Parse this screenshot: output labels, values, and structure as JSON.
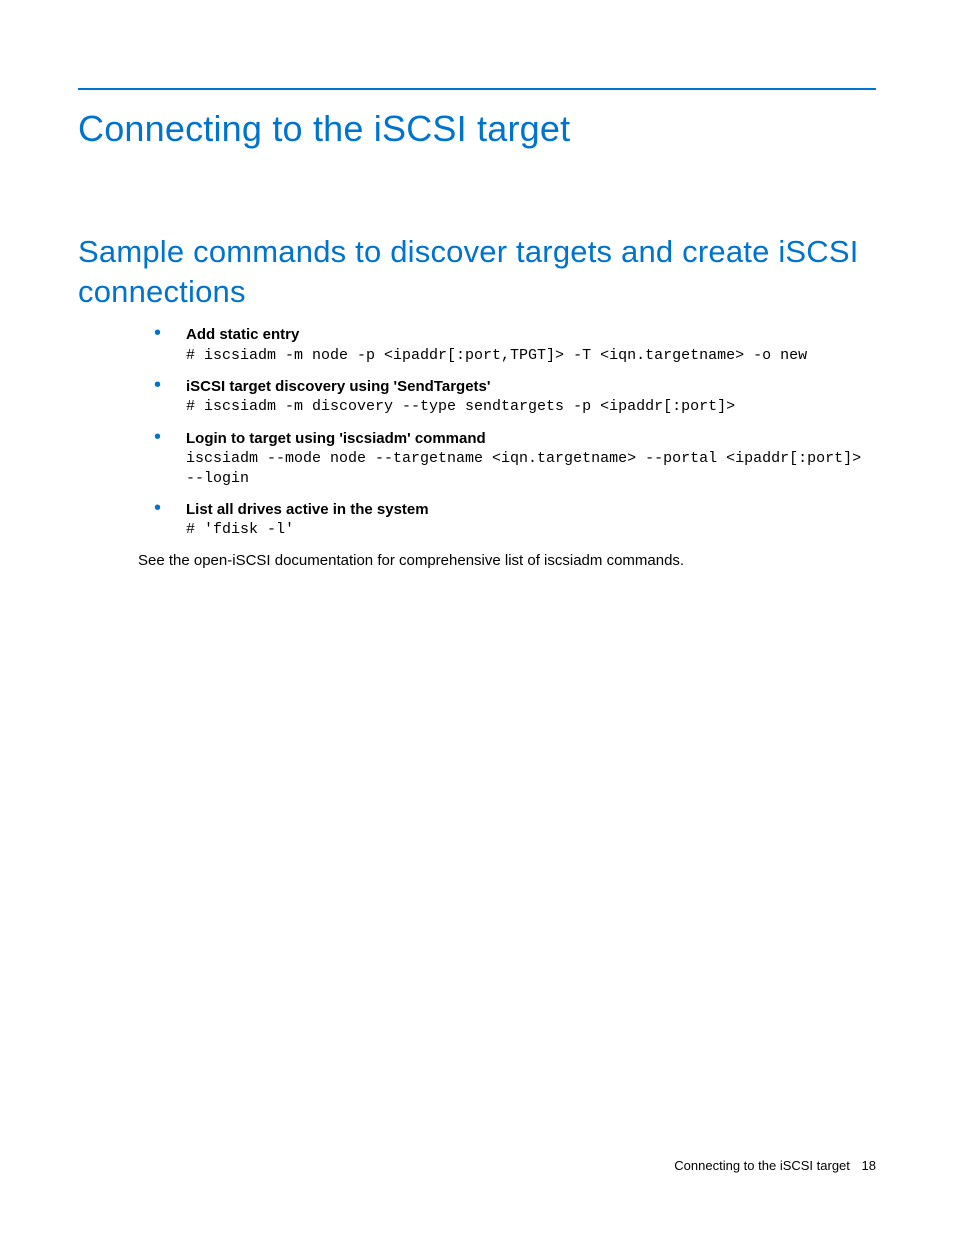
{
  "heading1": "Connecting to the iSCSI target",
  "heading2": "Sample commands to discover targets and create iSCSI connections",
  "items": [
    {
      "title": "Add static entry",
      "code": "# iscsiadm -m node -p <ipaddr[:port,TPGT]> -T <iqn.targetname> -o new"
    },
    {
      "title": "iSCSI target discovery using 'SendTargets'",
      "code": "# iscsiadm -m discovery --type sendtargets -p <ipaddr[:port]>"
    },
    {
      "title": "Login to target using 'iscsiadm' command",
      "code": "iscsiadm --mode node --targetname <iqn.targetname> --portal <ipaddr[:port]> --login"
    },
    {
      "title": "List all drives active in the system",
      "code": "# 'fdisk -l'"
    }
  ],
  "closing": "See the open-iSCSI documentation for comprehensive list of iscsiadm commands.",
  "footer": {
    "text": "Connecting to the iSCSI target",
    "page": "18"
  }
}
